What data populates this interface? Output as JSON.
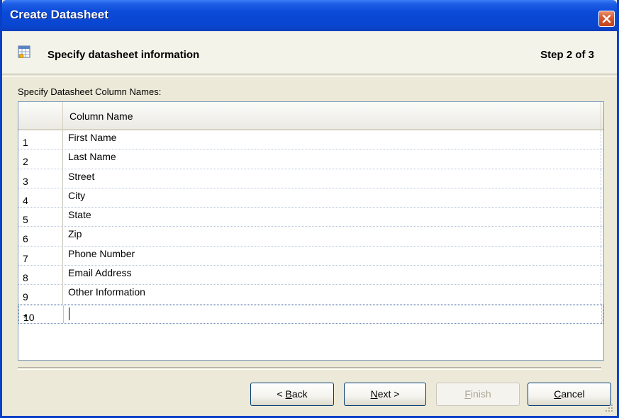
{
  "window": {
    "title": "Create Datasheet"
  },
  "header": {
    "heading": "Specify datasheet information",
    "step": "Step 2 of 3"
  },
  "grid": {
    "label": "Specify Datasheet Column Names:",
    "column_header": "Column Name",
    "rows": [
      {
        "num": "1",
        "value": "First Name"
      },
      {
        "num": "2",
        "value": "Last Name"
      },
      {
        "num": "3",
        "value": "Street"
      },
      {
        "num": "4",
        "value": "City"
      },
      {
        "num": "5",
        "value": "State"
      },
      {
        "num": "6",
        "value": "Zip"
      },
      {
        "num": "7",
        "value": "Phone Number"
      },
      {
        "num": "8",
        "value": "Email Address"
      },
      {
        "num": "9",
        "value": "Other Information"
      }
    ],
    "new_row": {
      "num": "10",
      "marker": "*",
      "value": ""
    }
  },
  "buttons": {
    "back": {
      "prefix": "< ",
      "mnemonic": "B",
      "rest": "ack"
    },
    "next": {
      "mnemonic": "N",
      "rest": "ext >"
    },
    "finish": {
      "mnemonic": "F",
      "rest": "inish",
      "enabled": false
    },
    "cancel": {
      "mnemonic": "C",
      "rest": "ancel"
    }
  },
  "colors": {
    "titlebar": "#0a4ad7",
    "close": "#d6562d",
    "dialog_bg": "#ece9d8"
  }
}
